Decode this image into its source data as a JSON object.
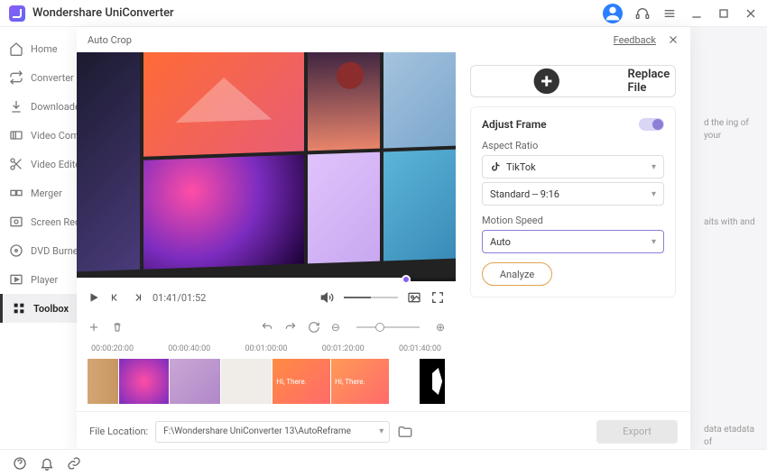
{
  "app": {
    "title": "Wondershare UniConverter"
  },
  "sidebar": {
    "items": [
      {
        "label": "Home"
      },
      {
        "label": "Converter"
      },
      {
        "label": "Downloader"
      },
      {
        "label": "Video Compressor"
      },
      {
        "label": "Video Editor"
      },
      {
        "label": "Merger"
      },
      {
        "label": "Screen Recorder"
      },
      {
        "label": "DVD Burner"
      },
      {
        "label": "Player"
      },
      {
        "label": "Toolbox"
      }
    ]
  },
  "modal": {
    "title": "Auto Crop",
    "feedback": "Feedback",
    "time": "01:41/01:52",
    "replace": "Replace File",
    "adjust": "Adjust Frame",
    "aspect_label": "Aspect Ratio",
    "aspect_platform": "TikTok",
    "aspect_value": "Standard -- 9:16",
    "motion_label": "Motion Speed",
    "motion_value": "Auto",
    "analyze": "Analyze",
    "location_label": "File Location:",
    "location_value": "F:\\Wondershare UniConverter 13\\AutoReframe",
    "export": "Export",
    "marks": [
      "00:00:20:00",
      "00:00:40:00",
      "00:01:00:00",
      "00:01:20:00",
      "00:01:40:00"
    ],
    "hi": "Hi, There.",
    "bg1": "d the\ning of your",
    "bg2": "aits with\nand",
    "bg3": "data\netadata of"
  }
}
